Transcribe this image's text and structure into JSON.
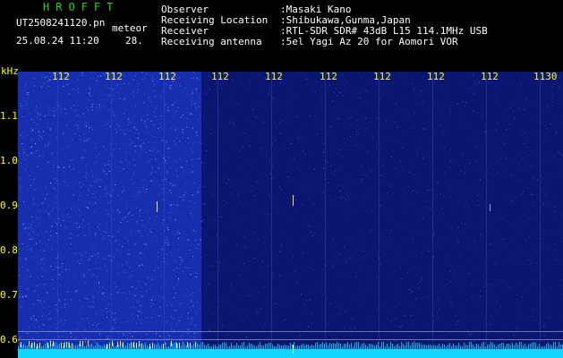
{
  "header": {
    "app_title": "HROFFT",
    "file_name": "UT2508241120.pn",
    "file_type": "meteor",
    "timestamp": "25.08.24 11:20",
    "count": "28.",
    "fields": [
      {
        "label": "Observer",
        "value": ":Masaki Kano"
      },
      {
        "label": "Receiving Location",
        "value": ":Shibukawa,Gunma,Japan"
      },
      {
        "label": "Receiver",
        "value": ":RTL-SDR SDR# 43dB L15 114.1MHz USB"
      },
      {
        "label": "Receiving antenna",
        "value": ":5el Yagi Az 20 for Aomori VOR"
      }
    ]
  },
  "spectrogram": {
    "y_unit": "kHz",
    "y_ticks": [
      "1.1",
      "1.0",
      "0.9",
      "0.8",
      "0.7",
      "0.6"
    ],
    "x_ticks": [
      "112",
      "112",
      "112",
      "112",
      "112",
      "112",
      "112",
      "112",
      "112",
      "1130"
    ],
    "colors": {
      "background": "#0a1670",
      "noise": "#3a6cff",
      "floor": "#12d6ff",
      "axis_text": "#ffff00",
      "marker": "#ffff66"
    }
  }
}
